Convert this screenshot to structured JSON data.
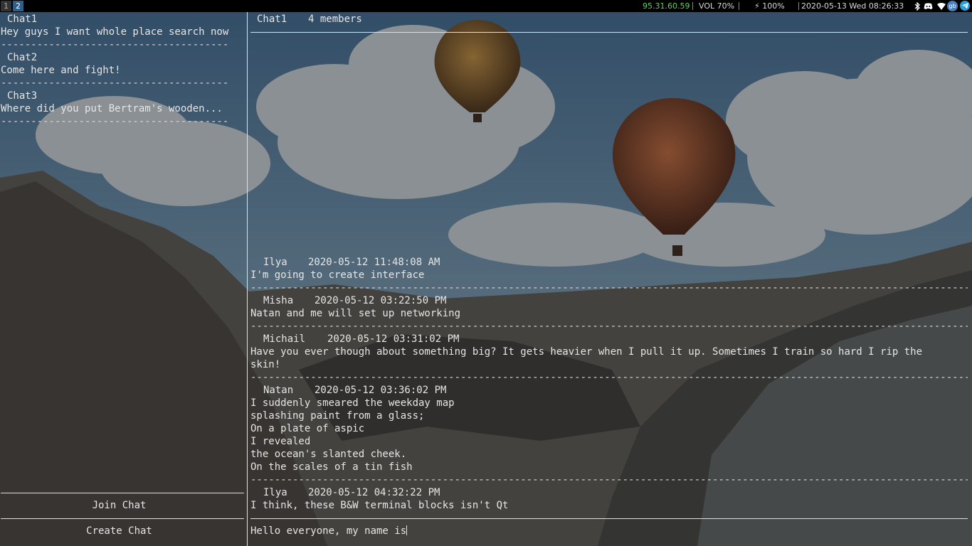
{
  "statusbar": {
    "workspaces": [
      "1",
      "2"
    ],
    "ip": "95.31.60.59",
    "volume": "VOL 70%",
    "battery": "⚡ 100%",
    "datetime": "2020-05-13 Wed 08:26:33",
    "tray_icons": [
      "bluetooth-icon",
      "discord-icon",
      "wifi-icon",
      "layout-indicator-icon",
      "telegram-icon"
    ],
    "layout_indicator": "gb"
  },
  "sidebar": {
    "chats": [
      {
        "name": "Chat1",
        "preview": "Hey guys I want whole place search now"
      },
      {
        "name": "Chat2",
        "preview": "Come here and fight!"
      },
      {
        "name": "Chat3",
        "preview": "Where did you put Bertram's wooden..."
      }
    ],
    "separator": "--------------------------------------",
    "join_label": "Join Chat",
    "create_label": "Create Chat"
  },
  "chat": {
    "title": "Chat1",
    "members": "4 members",
    "separator": "---------------------------------------------------------------------------------------------------------------------------------------------------------------",
    "messages": [
      {
        "author": "Ilya",
        "time": "2020-05-12 11:48:08 AM",
        "text": "I'm going to create interface"
      },
      {
        "author": "Misha",
        "time": "2020-05-12 03:22:50 PM",
        "text": "Natan and me will set up networking"
      },
      {
        "author": "Michail",
        "time": "2020-05-12 03:31:02 PM",
        "text": "Have you ever though about something big? It gets heavier when I pull it up. Sometimes I train so hard I rip the skin!"
      },
      {
        "author": "Natan",
        "time": "2020-05-12 03:36:02 PM",
        "text": "I suddenly smeared the weekday map\nsplashing paint from a glass;\nOn a plate of aspic\nI revealed\nthe ocean's slanted cheek.\nOn the scales of a tin fish"
      },
      {
        "author": "Ilya",
        "time": "2020-05-12 04:32:22 PM",
        "text": "I think, these B&W terminal blocks isn't Qt"
      }
    ],
    "input_value": "Hello everyone, my name is"
  }
}
